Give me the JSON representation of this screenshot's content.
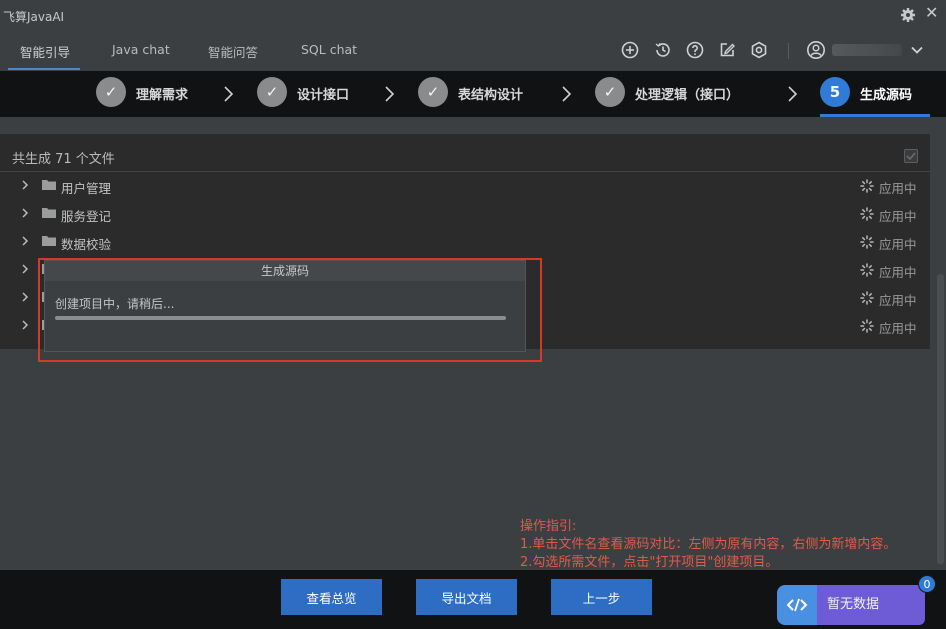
{
  "window": {
    "title": "飞算JavaAI",
    "close_glyph": "✕"
  },
  "tabs": [
    {
      "label": "智能引导",
      "active": true
    },
    {
      "label": "Java chat",
      "active": false
    },
    {
      "label": "智能问答",
      "active": false
    },
    {
      "label": "SQL chat",
      "active": false
    }
  ],
  "toolbar_icons": [
    "plus-circle-icon",
    "history-icon",
    "help-icon",
    "edit-icon",
    "settings-hex-icon"
  ],
  "steps": [
    {
      "label": "理解需求",
      "done": true
    },
    {
      "label": "设计接口",
      "done": true
    },
    {
      "label": "表结构设计",
      "done": true
    },
    {
      "label": "处理逻辑（接口）",
      "done": true
    },
    {
      "label": "生成源码",
      "number": "5",
      "active": true
    }
  ],
  "summary": "共生成 71 个文件",
  "rows": [
    {
      "name": "用户管理",
      "status": "应用中"
    },
    {
      "name": "服务登记",
      "status": "应用中"
    },
    {
      "name": "数据校验",
      "status": "应用中"
    },
    {
      "name": "",
      "status": "应用中"
    },
    {
      "name": "",
      "status": "应用中"
    },
    {
      "name": "",
      "status": "应用中"
    }
  ],
  "dialog": {
    "title": "生成源码",
    "message": "创建项目中，请稍后...",
    "progress": 1.0
  },
  "guide": {
    "title": "操作指引:",
    "line1": "1.单击文件名查看源码对比：左侧为原有内容，右侧为新增内容。",
    "line2": "2.勾选所需文件，点击\"打开项目\"创建项目。"
  },
  "buttons": {
    "overview": "查看总览",
    "export": "导出文档",
    "prev": "上一步"
  },
  "assistant": {
    "label": "暂无数据",
    "badge": "0"
  },
  "colors": {
    "accent": "#2f7bd5",
    "button": "#2d6dc4",
    "highlight": "#d43a2a",
    "guide_text": "#e05a4a"
  }
}
